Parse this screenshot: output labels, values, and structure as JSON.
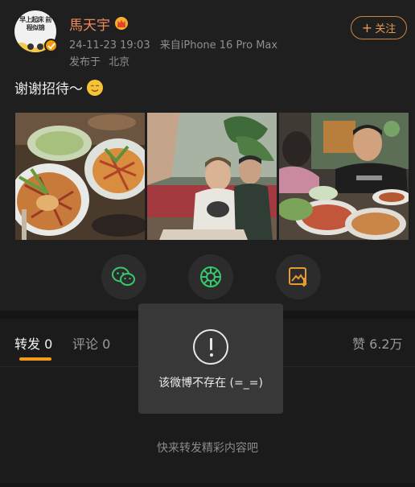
{
  "post": {
    "avatar_text": "早上起床 前程似锦",
    "username": "馬天宇",
    "vip_icon": "crown-badge-icon",
    "timestamp": "24-11-23 19:03",
    "source": "来自iPhone 16 Pro Max",
    "location_prefix": "发布于",
    "location": "北京",
    "follow_label": "关注",
    "follow_icon": "plus-icon",
    "text": "谢谢招待～",
    "text_emoji": "smile-emoji-icon",
    "photos": [
      "food-photo",
      "group-photo",
      "dinner-photo"
    ]
  },
  "share": {
    "items": [
      "wechat-icon",
      "moments-icon",
      "save-image-icon"
    ],
    "accent": "#36c96b"
  },
  "tabs": {
    "repost_label": "转发",
    "repost_count": "0",
    "comments_label": "评论",
    "comments_count": "0",
    "likes_label": "赞",
    "likes_count": "6.2万",
    "active_color": "#f39a1c"
  },
  "empty_hint": "快来转发精彩内容吧",
  "toast": {
    "icon": "exclamation-icon",
    "message": "该微博不存在 (=_=)"
  },
  "colors": {
    "username": "#f08a5d",
    "follow": "#e99a4e",
    "background": "#1b1b1b"
  }
}
